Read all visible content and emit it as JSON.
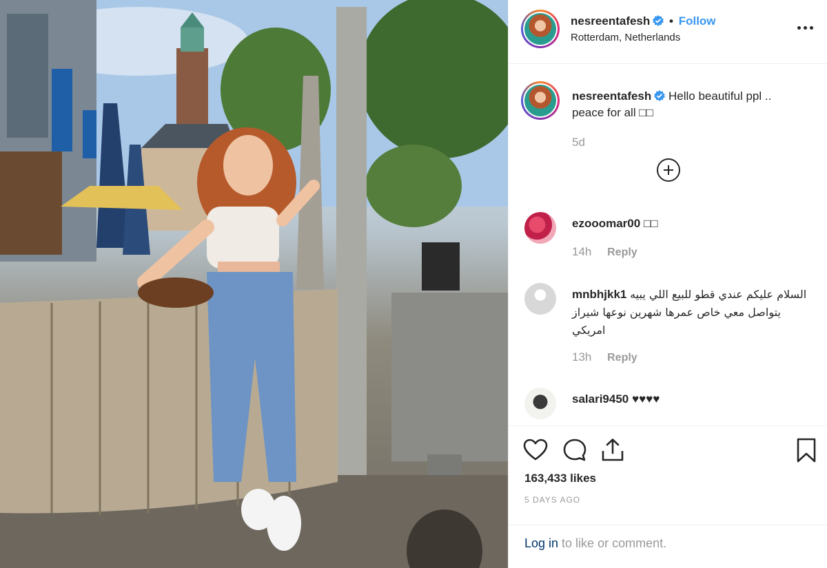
{
  "post": {
    "photo_alt": "",
    "header": {
      "username": "nesreentafesh",
      "separator": "•",
      "follow_label": "Follow",
      "location": "Rotterdam, Netherlands"
    },
    "caption": {
      "username": "nesreentafesh",
      "text": "Hello beautiful ppl .. peace for all □□",
      "time": "5d"
    },
    "comments": [
      {
        "username": "ezooomar00",
        "text": "□□",
        "time": "14h",
        "reply_label": "Reply"
      },
      {
        "username": "mnbhjkk1",
        "text": "السلام عليكم عندي قطو للبيع اللي يبيه يتواصل معي خاص عمرها شهرين نوعها شيراز امريكي",
        "time": "13h",
        "reply_label": "Reply"
      },
      {
        "username": "salari9450",
        "text": "♥♥♥♥"
      }
    ],
    "likes": "163,433 likes",
    "date": "5 DAYS AGO",
    "login": {
      "link": "Log in",
      "rest": " to like or comment."
    },
    "colors": {
      "accent": "#3897f0",
      "text": "#262626",
      "muted": "#999999",
      "link": "#003569"
    },
    "icons": [
      "verified-icon",
      "more-icon",
      "load-more-icon",
      "heart-icon",
      "comment-icon",
      "share-icon",
      "bookmark-icon"
    ]
  }
}
